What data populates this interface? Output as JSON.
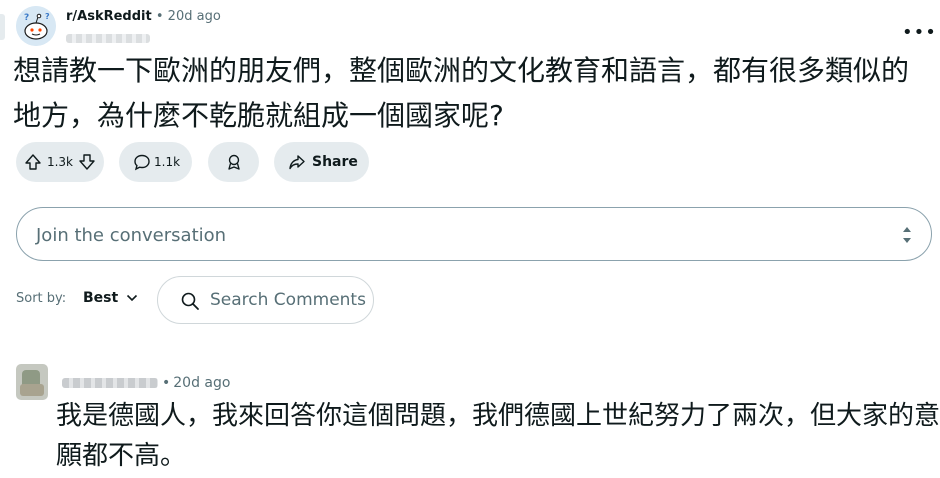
{
  "post": {
    "subreddit": "r/AskReddit",
    "separator": "•",
    "time": "20d ago",
    "title": "想請教一下歐洲的朋友們，整個歐洲的文化教育和語言，都有很多類似的地方，為什麼不乾脆就組成一個國家呢?",
    "more_label": "•••"
  },
  "actions": {
    "votes": "1.3k",
    "comments": "1.1k",
    "share_label": "Share"
  },
  "composer": {
    "placeholder": "Join the conversation"
  },
  "sort": {
    "label": "Sort by:",
    "value": "Best"
  },
  "search": {
    "placeholder": "Search Comments"
  },
  "comments": [
    {
      "separator": "•",
      "time": "20d ago",
      "body": "我是德國人，我來回答你這個問題，我們德國上世紀努力了兩次，但大家的意願都不高。"
    }
  ],
  "colors": {
    "pill_bg": "#e5ebee",
    "text": "#0f1a1c",
    "muted": "#576f76",
    "border": "#8ba2ad"
  }
}
